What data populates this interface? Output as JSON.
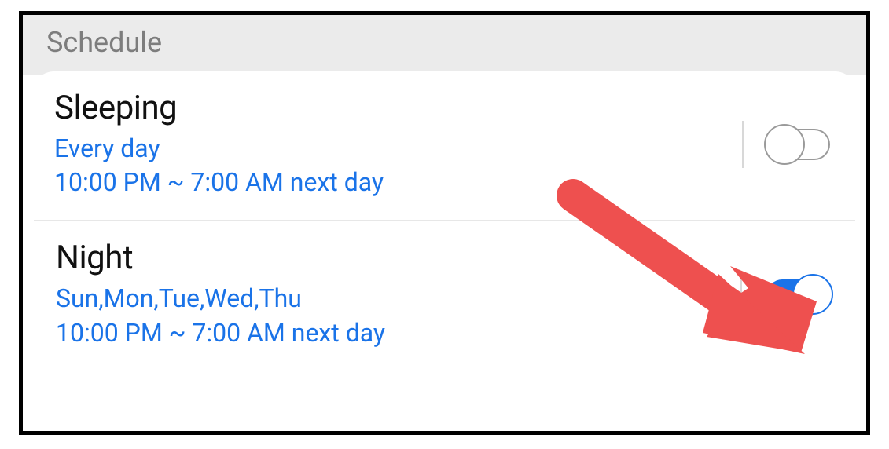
{
  "header": {
    "title": "Schedule"
  },
  "schedules": [
    {
      "title": "Sleeping",
      "days": "Every day",
      "time": "10:00 PM ~ 7:00 AM next day",
      "on": false
    },
    {
      "title": "Night",
      "days": "Sun,Mon,Tue,Wed,Thu",
      "time": "10:00 PM ~ 7:00 AM next day",
      "on": true
    }
  ],
  "colors": {
    "accent": "#1a73e8",
    "annotation": "#ef5350"
  }
}
